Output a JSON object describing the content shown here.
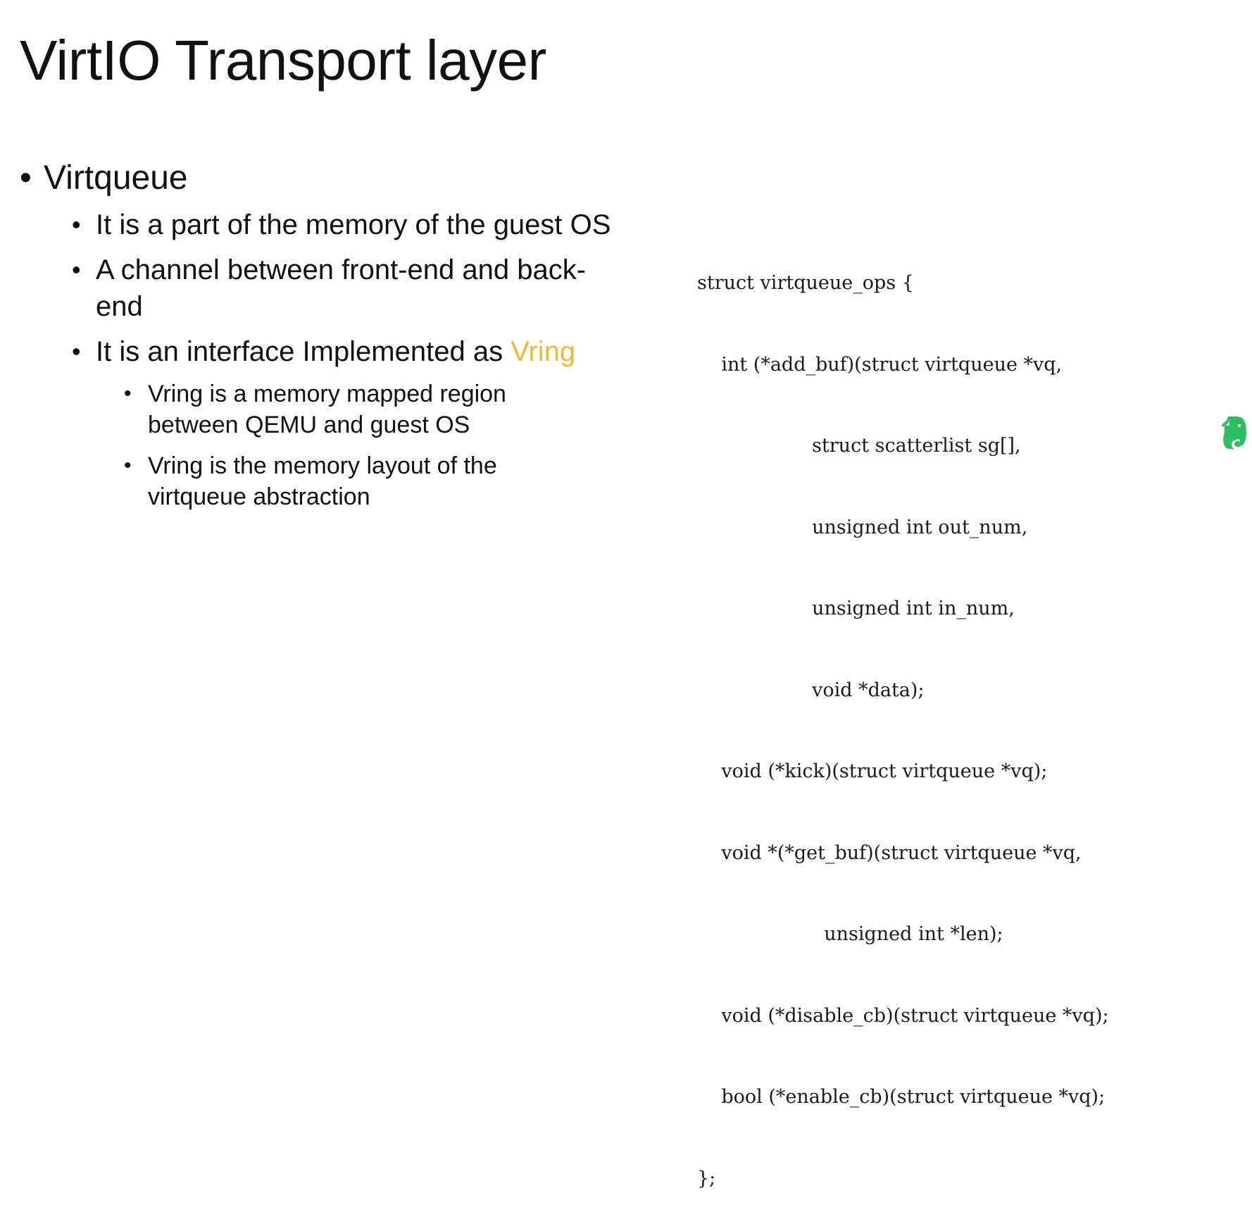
{
  "slide": {
    "title": "VirtIO Transport layer",
    "bullets": {
      "level1": "Virtqueue",
      "level2": [
        {
          "text": "It is a part of the memory of the guest OS"
        },
        {
          "text": "A channel between front-end and back-end"
        },
        {
          "text_before": "It is an interface Implemented as ",
          "accent": "Vring"
        }
      ],
      "level3": [
        {
          "text": "Vring is a memory mapped  region between QEMU and guest OS"
        },
        {
          "text": "Vring is the memory layout of the virtqueue abstraction"
        }
      ]
    },
    "code": [
      "struct virtqueue_ops {",
      "    int (*add_buf)(struct virtqueue *vq,",
      "                   struct scatterlist sg[],",
      "                   unsigned int out_num,",
      "                   unsigned int in_num,",
      "                   void *data);",
      "    void (*kick)(struct virtqueue *vq);",
      "    void *(*get_buf)(struct virtqueue *vq,",
      "                     unsigned int *len);",
      "    void (*disable_cb)(struct virtqueue *vq);",
      "    bool (*enable_cb)(struct virtqueue *vq);",
      "};"
    ],
    "icons": {
      "overlay": "evernote-elephant-icon"
    },
    "colors": {
      "accent": "#f0b92e",
      "evernote_green": "#2dbe60"
    }
  }
}
